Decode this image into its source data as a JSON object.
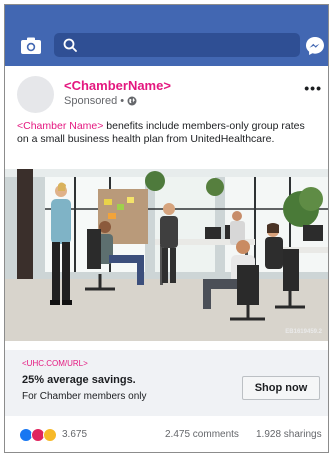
{
  "topbar": {
    "search_placeholder": "",
    "camera_icon": "camera-icon",
    "search_icon": "search-icon",
    "messenger_icon": "messenger-icon",
    "background": "#4267b2"
  },
  "post": {
    "page_name": "<ChamberName>",
    "sponsored_label": "Sponsored",
    "separator": "•",
    "globe_icon": "globe-icon",
    "more_label": "•••",
    "text_tag": "<Chamber Name>",
    "text_body": " benefits include members-only group rates on a small business health plan from UnitedHealthcare.",
    "photo_id": "EB1619459.2",
    "accent_color": "#e4177f"
  },
  "cta": {
    "url": "<UHC.COM/URL>",
    "headline": "25% average savings.",
    "description": "For Chamber members only",
    "button_label": "Shop now"
  },
  "stats": {
    "reaction_count": "3.675",
    "comments": "2.475 comments",
    "shares": "1.928 sharings"
  }
}
